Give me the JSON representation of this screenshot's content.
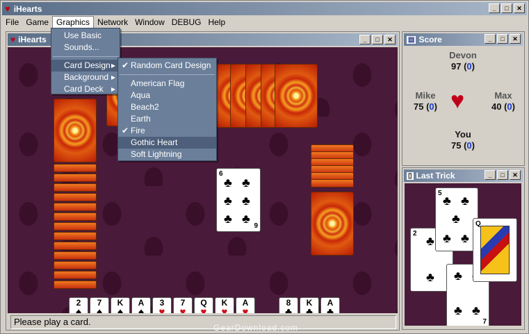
{
  "app": {
    "title": "iHearts"
  },
  "menubar": [
    "File",
    "Game",
    "Graphics",
    "Network",
    "Window",
    "DEBUG",
    "Help"
  ],
  "game_window": {
    "title": "iHearts"
  },
  "graphics_menu": [
    "Use Basic",
    "Sounds...",
    "Card Design",
    "Background",
    "Card Deck"
  ],
  "card_design_menu": {
    "random": "Random Card Design",
    "items": [
      "American Flag",
      "Aqua",
      "Beach2",
      "Earth",
      "Fire",
      "Gothic Heart",
      "Soft Lightning"
    ],
    "checked": [
      "Random Card Design",
      "Fire"
    ],
    "highlighted": "Gothic Heart"
  },
  "played_card": {
    "rank": "6",
    "suit": "♣",
    "corner_bottom": "9"
  },
  "hand": [
    {
      "rank": "2",
      "suit": "♠"
    },
    {
      "rank": "7",
      "suit": "♠"
    },
    {
      "rank": "K",
      "suit": "♠"
    },
    {
      "rank": "A",
      "suit": "♠"
    },
    {
      "rank": "3",
      "suit": "♥"
    },
    {
      "rank": "7",
      "suit": "♥"
    },
    {
      "rank": "Q",
      "suit": "♥"
    },
    {
      "rank": "K",
      "suit": "♥"
    },
    {
      "rank": "A",
      "suit": "♥"
    },
    {
      "rank": "8",
      "suit": "♣"
    },
    {
      "rank": "K",
      "suit": "♣"
    },
    {
      "rank": "A",
      "suit": "♣"
    }
  ],
  "status": "Please play a card.",
  "score_window": {
    "title": "Score",
    "players": [
      {
        "name": "Devon",
        "score": "97",
        "change": "0"
      },
      {
        "name": "Mike",
        "score": "75",
        "change": "0"
      },
      {
        "name": "Max",
        "score": "40",
        "change": "0"
      },
      {
        "name": "You",
        "score": "75",
        "change": "0"
      }
    ]
  },
  "last_trick": {
    "title": "Last Trick",
    "cards": [
      "2",
      "5",
      "Q",
      "7"
    ]
  },
  "watermark": "GearDownload.com",
  "colors": {
    "felt": "#4a1a3a",
    "title_bar": "#5a6e88",
    "score_change": "#1a3cc8",
    "hearts_red": "#d0101a"
  }
}
